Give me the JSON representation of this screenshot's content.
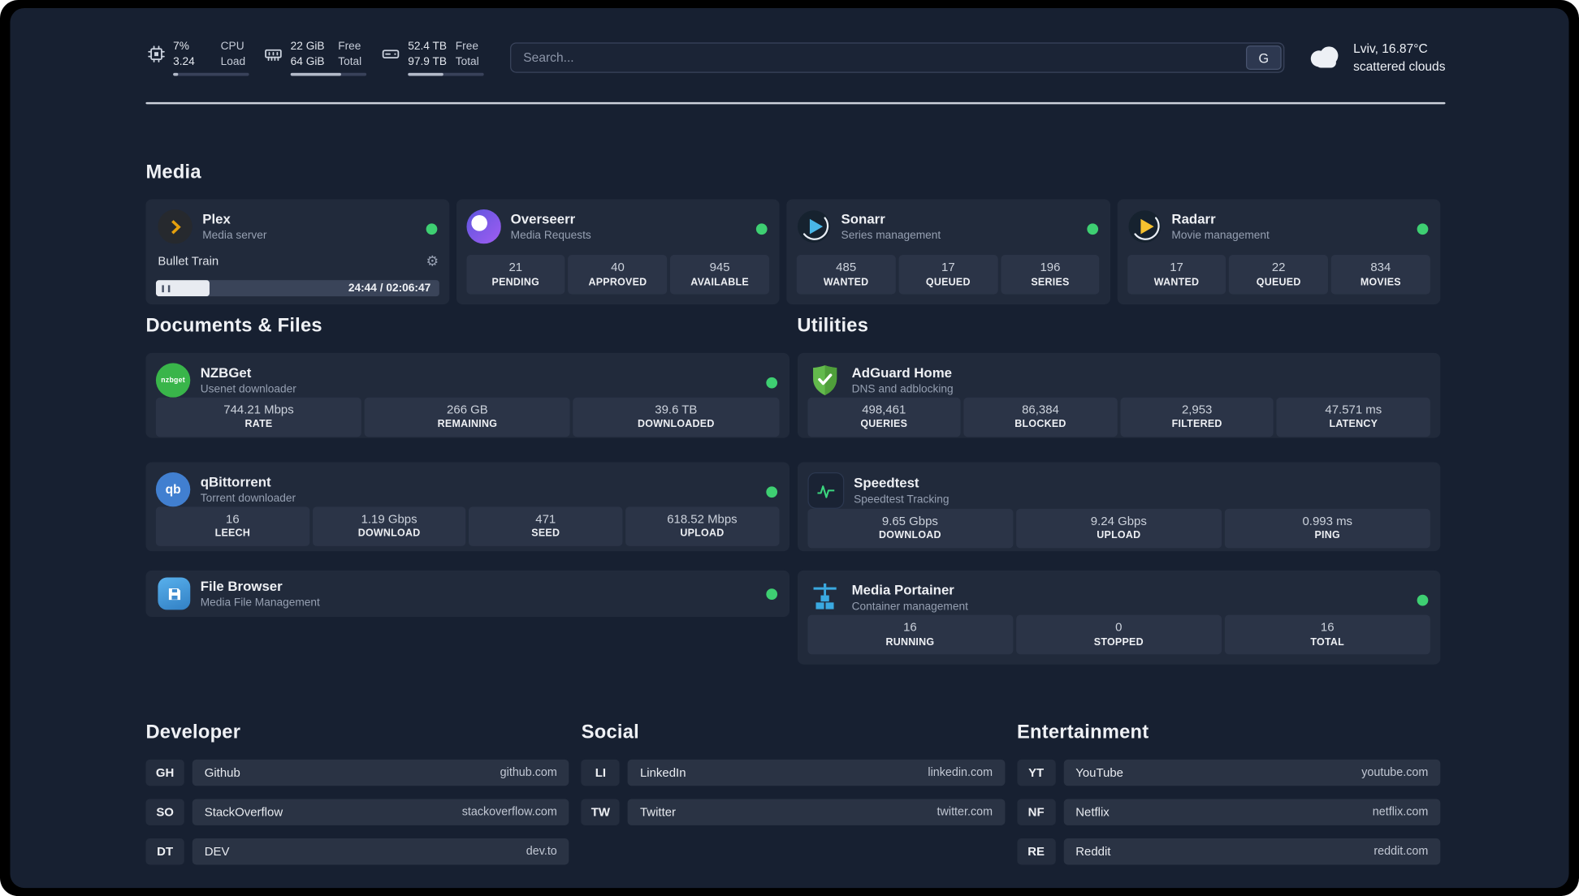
{
  "colors": {
    "status_online": "#3ecf72"
  },
  "topbar": {
    "cpu": {
      "value_top": "7%",
      "value_bottom": "3.24",
      "label_top": "CPU",
      "label_bottom": "Load",
      "bar_percent": 7
    },
    "ram": {
      "value_top": "22 GiB",
      "value_bottom": "64 GiB",
      "label_top": "Free",
      "label_bottom": "Total",
      "bar_percent": 66
    },
    "disk": {
      "value_top": "52.4 TB",
      "value_bottom": "97.9 TB",
      "label_top": "Free",
      "label_bottom": "Total",
      "bar_percent": 46
    },
    "search": {
      "placeholder": "Search...",
      "engine_label": "G"
    },
    "weather": {
      "location": "Lviv, 16.87°C",
      "condition": "scattered clouds"
    }
  },
  "sections": {
    "media": {
      "title": "Media",
      "plex": {
        "name": "Plex",
        "subtitle": "Media server",
        "now_playing": "Bullet Train",
        "time": "24:44 / 02:06:47",
        "progress_percent": 19
      },
      "overseerr": {
        "name": "Overseerr",
        "subtitle": "Media Requests",
        "stats": [
          {
            "value": "21",
            "label": "PENDING"
          },
          {
            "value": "40",
            "label": "APPROVED"
          },
          {
            "value": "945",
            "label": "AVAILABLE"
          }
        ]
      },
      "sonarr": {
        "name": "Sonarr",
        "subtitle": "Series management",
        "stats": [
          {
            "value": "485",
            "label": "WANTED"
          },
          {
            "value": "17",
            "label": "QUEUED"
          },
          {
            "value": "196",
            "label": "SERIES"
          }
        ]
      },
      "radarr": {
        "name": "Radarr",
        "subtitle": "Movie management",
        "stats": [
          {
            "value": "17",
            "label": "WANTED"
          },
          {
            "value": "22",
            "label": "QUEUED"
          },
          {
            "value": "834",
            "label": "MOVIES"
          }
        ]
      }
    },
    "documents": {
      "title": "Documents & Files",
      "nzbget": {
        "name": "NZBGet",
        "subtitle": "Usenet downloader",
        "icon_text": "nzbget",
        "stats": [
          {
            "value": "744.21 Mbps",
            "label": "RATE"
          },
          {
            "value": "266 GB",
            "label": "REMAINING"
          },
          {
            "value": "39.6 TB",
            "label": "DOWNLOADED"
          }
        ]
      },
      "qbittorrent": {
        "name": "qBittorrent",
        "subtitle": "Torrent downloader",
        "icon_text": "qb",
        "stats": [
          {
            "value": "16",
            "label": "LEECH"
          },
          {
            "value": "1.19 Gbps",
            "label": "DOWNLOAD"
          },
          {
            "value": "471",
            "label": "SEED"
          },
          {
            "value": "618.52 Mbps",
            "label": "UPLOAD"
          }
        ]
      },
      "filebrowser": {
        "name": "File Browser",
        "subtitle": "Media File Management"
      }
    },
    "utilities": {
      "title": "Utilities",
      "adguard": {
        "name": "AdGuard Home",
        "subtitle": "DNS and adblocking",
        "stats": [
          {
            "value": "498,461",
            "label": "QUERIES"
          },
          {
            "value": "86,384",
            "label": "BLOCKED"
          },
          {
            "value": "2,953",
            "label": "FILTERED"
          },
          {
            "value": "47.571 ms",
            "label": "LATENCY"
          }
        ]
      },
      "speedtest": {
        "name": "Speedtest",
        "subtitle": "Speedtest Tracking",
        "stats": [
          {
            "value": "9.65 Gbps",
            "label": "DOWNLOAD"
          },
          {
            "value": "9.24 Gbps",
            "label": "UPLOAD"
          },
          {
            "value": "0.993 ms",
            "label": "PING"
          }
        ]
      },
      "portainer": {
        "name": "Media Portainer",
        "subtitle": "Container management",
        "stats": [
          {
            "value": "16",
            "label": "RUNNING"
          },
          {
            "value": "0",
            "label": "STOPPED"
          },
          {
            "value": "16",
            "label": "TOTAL"
          }
        ]
      }
    },
    "links": {
      "developer": {
        "title": "Developer",
        "items": [
          {
            "abbr": "GH",
            "name": "Github",
            "url": "github.com"
          },
          {
            "abbr": "SO",
            "name": "StackOverflow",
            "url": "stackoverflow.com"
          },
          {
            "abbr": "DT",
            "name": "DEV",
            "url": "dev.to"
          }
        ]
      },
      "social": {
        "title": "Social",
        "items": [
          {
            "abbr": "LI",
            "name": "LinkedIn",
            "url": "linkedin.com"
          },
          {
            "abbr": "TW",
            "name": "Twitter",
            "url": "twitter.com"
          }
        ]
      },
      "entertainment": {
        "title": "Entertainment",
        "items": [
          {
            "abbr": "YT",
            "name": "YouTube",
            "url": "youtube.com"
          },
          {
            "abbr": "NF",
            "name": "Netflix",
            "url": "netflix.com"
          },
          {
            "abbr": "RE",
            "name": "Reddit",
            "url": "reddit.com"
          }
        ]
      }
    }
  }
}
